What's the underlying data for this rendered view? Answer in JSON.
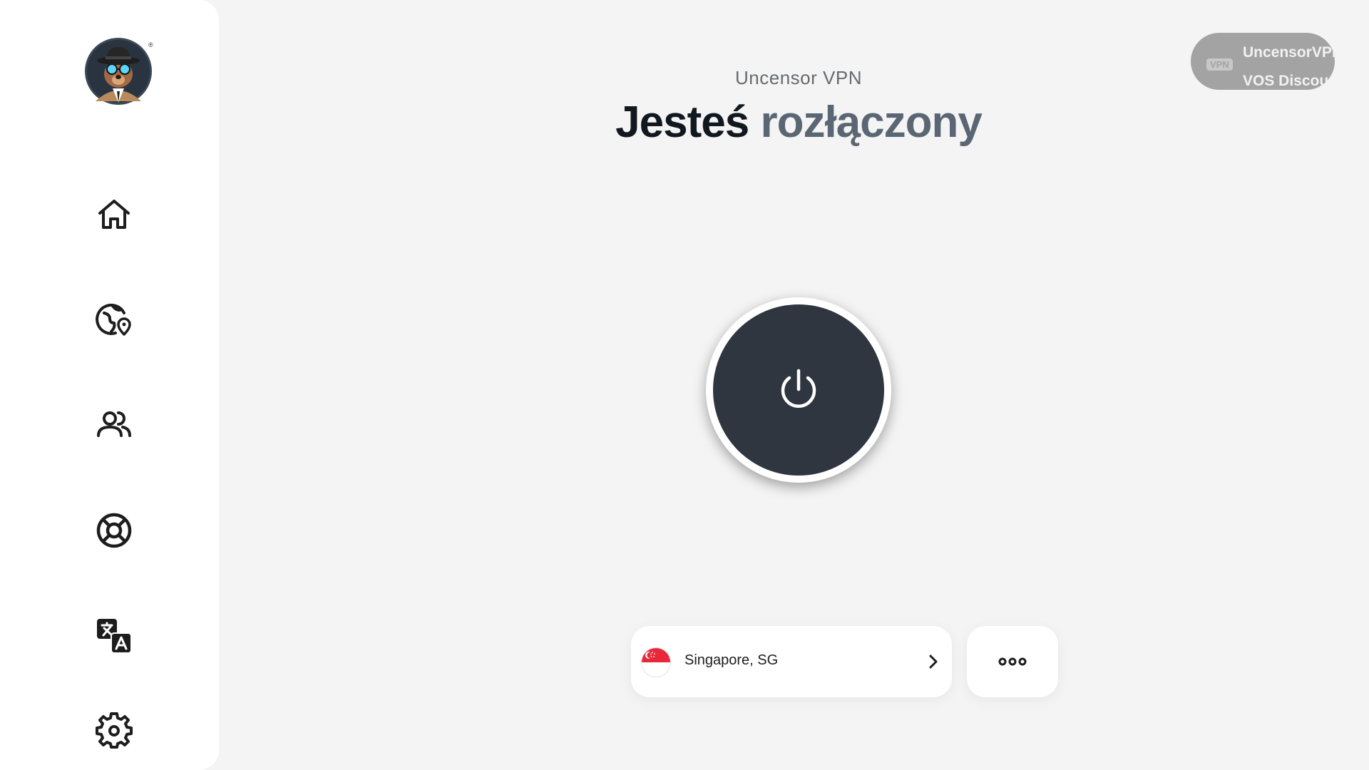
{
  "app": {
    "name": "Uncensor VPN",
    "status_prefix": "Jesteś",
    "status_state": "rozłączony"
  },
  "sidebar": {
    "logo_icon": "spy-mascot-logo",
    "logo_mark": "®",
    "items": [
      {
        "icon": "home-icon"
      },
      {
        "icon": "globe-location-icon"
      },
      {
        "icon": "users-icon"
      },
      {
        "icon": "lifebuoy-icon"
      },
      {
        "icon": "translate-icon"
      },
      {
        "icon": "gear-icon"
      }
    ]
  },
  "promo": {
    "tag": "VPN",
    "line1": "UncensorVPN",
    "line2": "VOS Discount"
  },
  "power": {
    "icon": "power-icon",
    "state": "disconnected"
  },
  "location": {
    "label": "Singapore, SG",
    "flag": "singapore-flag",
    "chevron": "chevron-right-icon"
  },
  "more": {
    "icon": "more-dots-icon"
  },
  "colors": {
    "background": "#f4f4f4",
    "sidebar": "#ffffff",
    "power_fill": "#2f3640",
    "status_dark": "#121820",
    "status_muted": "#5b6674",
    "badge": "#a3a3a3"
  }
}
